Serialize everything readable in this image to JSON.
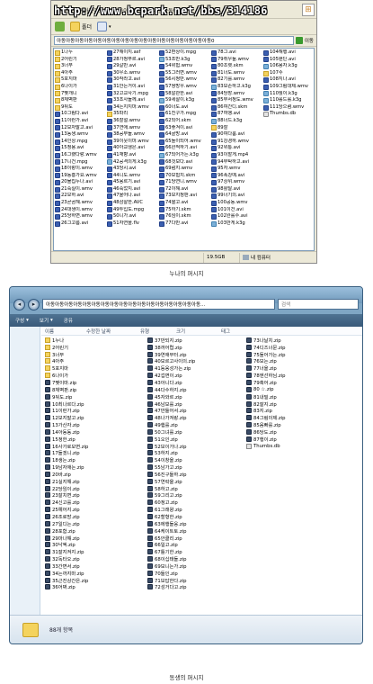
{
  "xp_window": {
    "watermark": "http://www.bcpark.net/bbs/314186",
    "menu_text": "아동아동아동아동아동아동아동아동아동아동아동아동아동아동",
    "toolbar": {
      "up_label": "폴더"
    },
    "address": {
      "value": "아동아동아동아동아동아동아동아동아동아동아동아동아동아동아동아동아동0",
      "go_label": "이동"
    },
    "columns": [
      [
        "1나누",
        "2어린기",
        "3너무",
        "4아주",
        "5포지마",
        "6나이가",
        "7몇개니",
        "8체벽판",
        "9뒤도",
        "10그림다.avi",
        "11이런가.avi",
        "12보자말고.avi",
        "13동생.wmv",
        "14인상.mpg",
        "15정용.avi",
        "16그랬다랑.wmv",
        "17니건.mpg",
        "18이랑이.wmv",
        "19동흥가요.wmv",
        "20물집누나.avi",
        "21숙실이.wmv",
        "22모하.avi",
        "23곧곰해.wmv",
        "24대생이.wmv",
        "25당하면.wmv",
        "26그고름.avi"
      ],
      [
        "27해이지.asf",
        "28가정부르.avi",
        "29갈만.avi",
        "30우소.wmv",
        "30작라고.avi",
        "31안는거이.avi",
        "32고교사기.mpg",
        "33조사들께.avi",
        "34는지지마.wmv",
        "35파리",
        "36잘설.wmv",
        "37연애.wmv",
        "38공부들.wmv",
        "39이웃이마.wmv",
        "40아교생은.avi",
        "41재향.avi",
        "42공격의게.k3g",
        "43당시.avi",
        "44니도.wmv",
        "45몽르기.avi",
        "46죽었지.avi",
        "47울어나.avi",
        "48삼살한.AVC",
        "49투입도.mpg",
        "50니가.avi",
        "51자연을.flv"
      ],
      [
        "52환상이.mpg",
        "53조반.k3g",
        "54위험.wmv",
        "55그러면.wmv",
        "56시정반.wmv",
        "57쌍방우.wmv",
        "58알관한.avi",
        "59세살이.k3g",
        "60너도.avi",
        "61친구가.mpg",
        "62되어.skm",
        "63좋겨이.avi",
        "64골방.avi",
        "65돌이되어.wmv",
        "66완적하기.avi",
        "67되어가는.k3g",
        "68것보다.avi",
        "69럼지.wmv",
        "70보험치.skm",
        "71당연니.wmv",
        "72이해.avi",
        "73보지정판.avi",
        "74쌀고.avi",
        "75하기.skm",
        "76임이.skm",
        "77다만.avi"
      ],
      [
        "78그.avi",
        "79취우들.wmv",
        "80초렛.skm",
        "81너도.wmv",
        "82기를.wmv",
        "83보존하고.k3g",
        "84당장.wmv",
        "85부서정도.wmv",
        "86여간디.skm",
        "87여앵.avi",
        "88너드.k3g",
        "89잘",
        "90여다룸.avi",
        "91강경하.wmv",
        "92위통.avi",
        "93이할게.mp4",
        "94부탁하고.avi",
        "95자.wmv",
        "96폭강예.avi",
        "97상위.wmv",
        "98활달.avi",
        "99너기의.avi",
        "100공동.wmv",
        "101이건.avi",
        "102완롤수.avi",
        "103만게.k3g"
      ],
      [
        "104해행.avi",
        "105왠딘.avi",
        "106용자.k3g",
        "107수",
        "108지나.avi",
        "109그림대제.wmv",
        "110뭘이.k3g",
        "110롤드롤.k3g",
        "111당으렴.wmv",
        "Thumbs.db"
      ]
    ],
    "status": {
      "size": "19.5GB",
      "location": "내 컴퓨터"
    }
  },
  "caption_top": "누나의 퍼시지",
  "vista_window": {
    "address": "아동아동아동아동아동아동아동아동아동아동아동아동아동아동아동아동아동...",
    "search_placeholder": "검색",
    "commands": {
      "organize": "구성",
      "views": "보기",
      "share": "공유"
    },
    "headers": {
      "name": "이름",
      "modified": "수정한 날짜",
      "type": "유형",
      "size": "크기",
      "tags": "태그"
    },
    "columns": [
      [
        "1누나",
        "2어린기",
        "3너무",
        "4아주",
        "5포지마",
        "6나이가",
        "7몇이마.zip",
        "8체벽판.zip",
        "9뒤도.zip",
        "10최나르다.zip",
        "11이런가.zip",
        "12보지말고.zip",
        "13가산자.zip",
        "14아동동.zip",
        "15정한.zip",
        "16사가로모면.zip",
        "17들겠니.zip",
        "18생는.zip",
        "19남자애는.zip",
        "20바.zip",
        "21실지해.zip",
        "22당임이.zip",
        "23잘치면.zip",
        "24신고를.zip",
        "25예어지.zip",
        "26조로망.zip",
        "27일디는.zip",
        "28포함.zip",
        "29마나해.zip",
        "30낙엑.zip",
        "31잘지켜지.zip",
        "32독타오.zip",
        "33간면서.zip",
        "34는까지마.zip",
        "35근진상간은.zip",
        "36어쩌.zip"
      ],
      [
        "37만되지.zip",
        "38까어렵.zip",
        "39연애부터.zip",
        "40모르고사이의.zip",
        "41등웅성가는.zip",
        "42겁면이.zip",
        "43아니다.zip",
        "44다수하지.zip",
        "45자와르.zip",
        "46남보를.zip",
        "47만들어서.zip",
        "48나가져랑.zip",
        "49햄를.zip",
        "50그녀를.zip",
        "51오인.zip",
        "52보이가나.zip",
        "53하지.zip",
        "54이창을.zip",
        "55남가고.zip",
        "56진구들하.zip",
        "57연락을.zip",
        "58하고.zip",
        "59그리고.zip",
        "60정고.zip",
        "61그래왕.zip",
        "62할형한.zip",
        "63에행들응.zip",
        "64케이트토.zip",
        "65안클리.zip",
        "66일고.zip",
        "67틀기한.zip",
        "68이십태들.zip",
        "69보니는가.zip",
        "70들인.zip",
        "71보답한다.zip",
        "72성거다고.zip"
      ],
      [
        "73나날치.zip",
        "74디즈너문.zip",
        "75둘어가는.zip",
        "76모는.zip",
        "77너을.zip",
        "78엔선하님.zip",
        "79혹어.zip",
        "80 ☆.zip",
        "81내밀.zip",
        "82잘지.zip",
        "83지.zip",
        "84그림이제.zip",
        "85음빠를.zip",
        "86당도.zip",
        "87행이.zip",
        "Thumbs.db"
      ]
    ],
    "details": {
      "count": "88개 항목"
    }
  },
  "caption_bottom": "동생의 퍼시지"
}
